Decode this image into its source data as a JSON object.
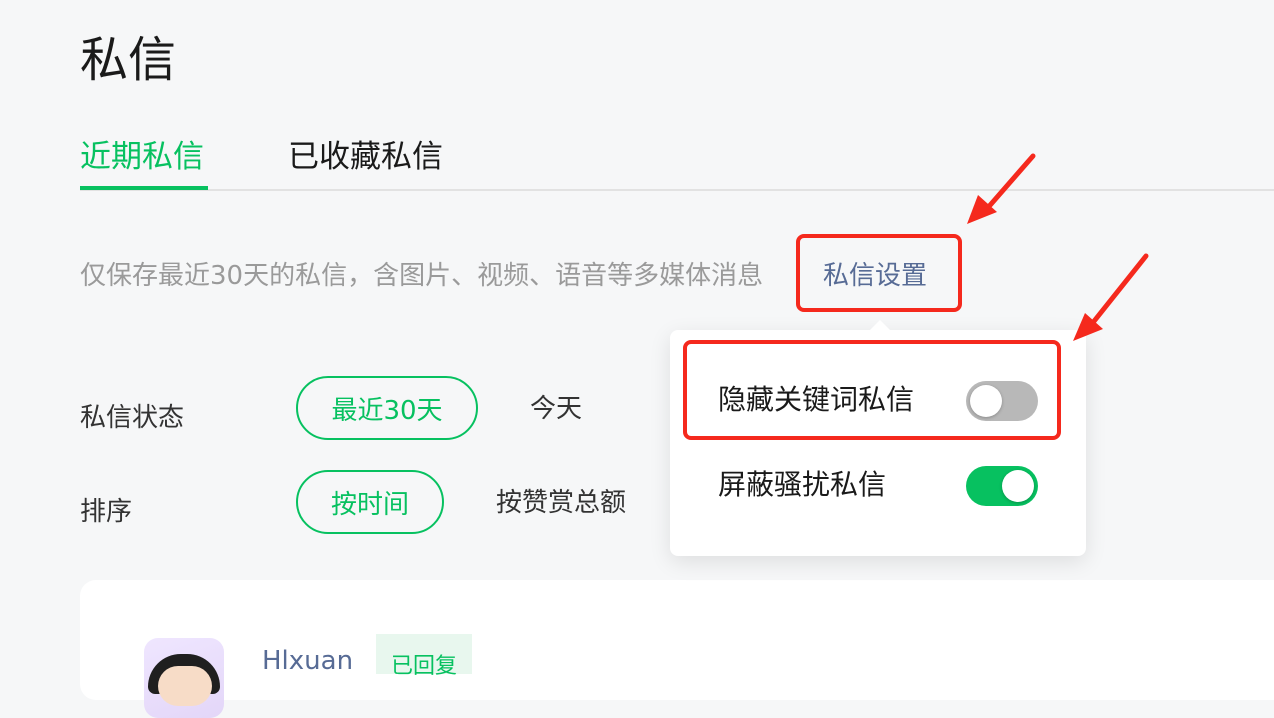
{
  "page": {
    "title": "私信"
  },
  "tabs": [
    {
      "label": "近期私信",
      "active": true
    },
    {
      "label": "已收藏私信",
      "active": false
    }
  ],
  "notice": {
    "text": "仅保存最近30天的私信，含图片、视频、语音等多媒体消息",
    "settings_link": "私信设置"
  },
  "filters": {
    "status_label": "私信状态",
    "status_options": [
      {
        "label": "最近30天",
        "selected": true
      },
      {
        "label": "今天",
        "selected": false
      }
    ],
    "sort_label": "排序",
    "sort_options": [
      {
        "label": "按时间",
        "selected": true
      },
      {
        "label": "按赞赏总额",
        "selected": false
      }
    ]
  },
  "message_list": [
    {
      "username": "Hlxuan",
      "badge": "已回复"
    }
  ],
  "settings_popover": {
    "items": [
      {
        "label": "隐藏关键词私信",
        "enabled": false
      },
      {
        "label": "屏蔽骚扰私信",
        "enabled": true
      }
    ]
  },
  "colors": {
    "accent": "#07c160",
    "link": "#576b95",
    "annotation": "#f5291d",
    "toggle_off": "#b8b8b8"
  }
}
